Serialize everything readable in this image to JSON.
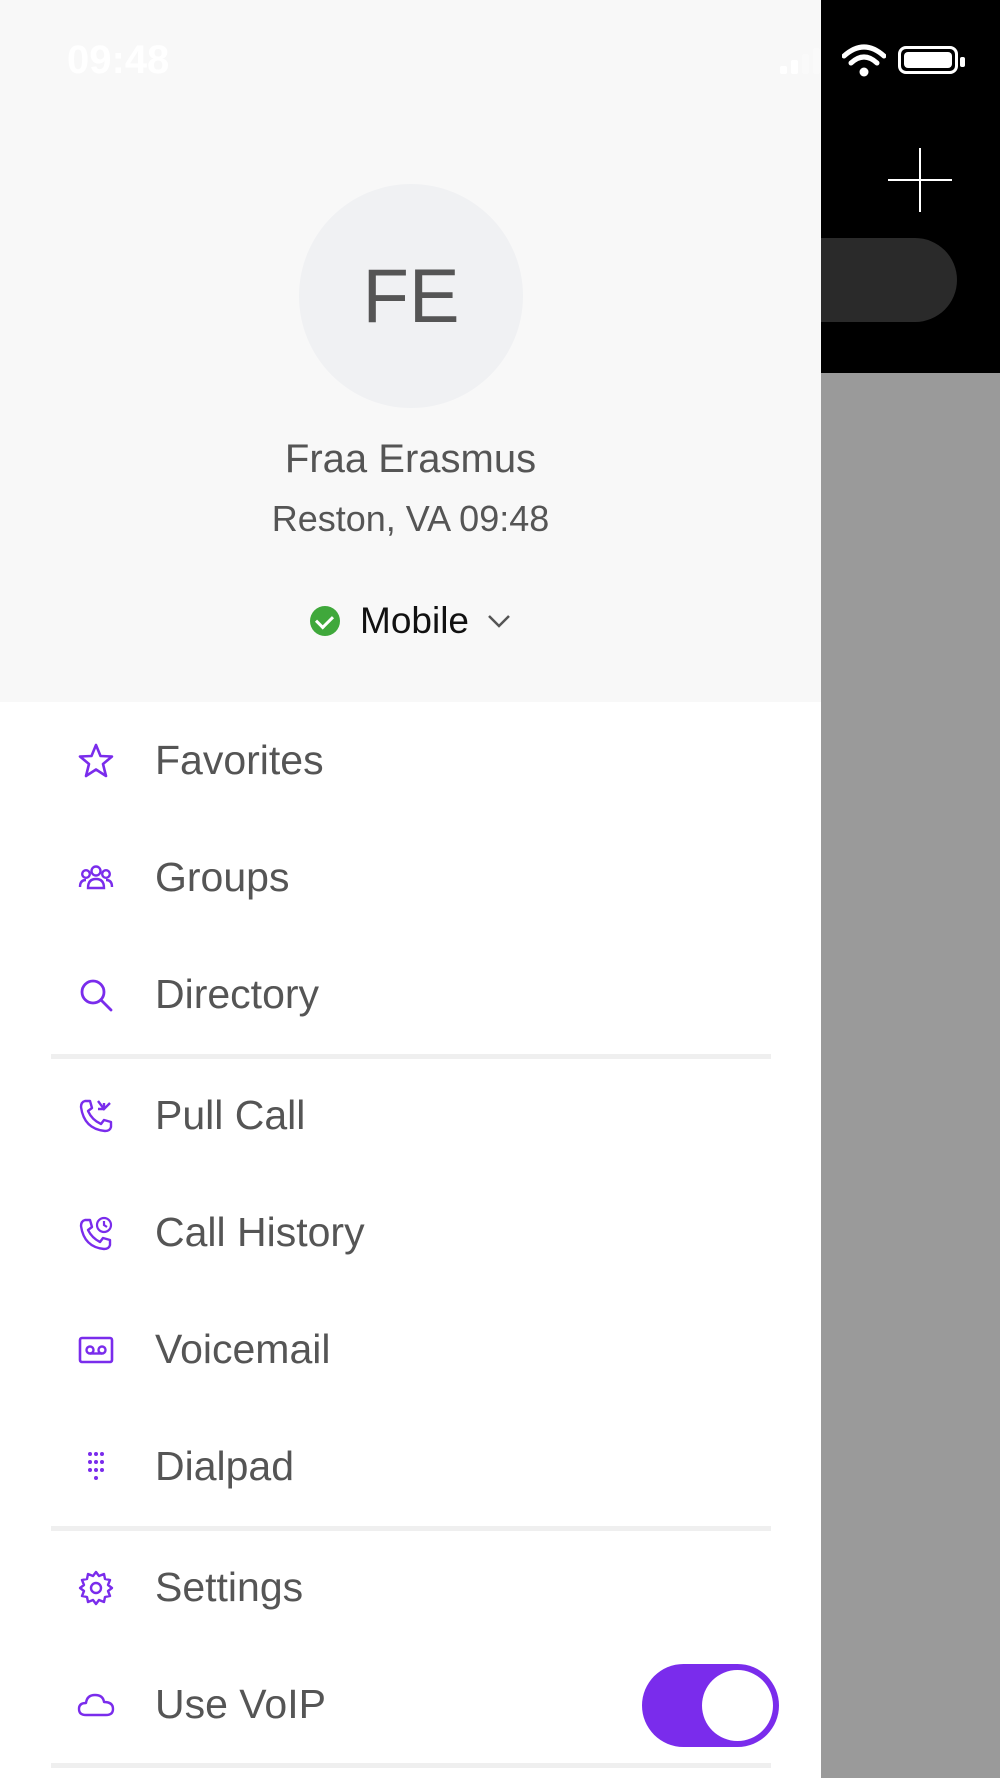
{
  "status_bar": {
    "time": "09:48"
  },
  "profile": {
    "initials": "FE",
    "name": "Fraa Erasmus",
    "location": "Reston, VA 09:48",
    "presence": "Mobile"
  },
  "menu": {
    "favorites": "Favorites",
    "groups": "Groups",
    "directory": "Directory",
    "pull_call": "Pull Call",
    "call_history": "Call History",
    "voicemail": "Voicemail",
    "dialpad": "Dialpad",
    "settings": "Settings",
    "use_voip": "Use VoIP"
  },
  "toggles": {
    "use_voip_on": true
  },
  "colors": {
    "accent": "#7a2cec",
    "presence_available": "#3fa83b",
    "header_bg": "#f8f8f8"
  }
}
